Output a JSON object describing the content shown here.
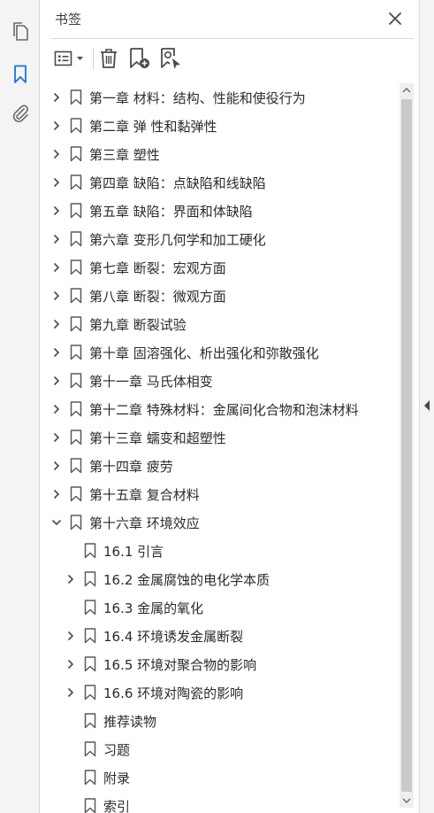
{
  "panel": {
    "title": "书签"
  },
  "toolbar": {
    "options_icon": "list-options-icon",
    "delete_icon": "trash-icon",
    "new_bookmark_icon": "bookmark-add-icon",
    "find_bookmark_icon": "bookmark-search-icon"
  },
  "colors": {
    "accent": "#1473e6",
    "rail_bg": "#f4f4f4",
    "scroll_thumb": "#c9c9c9"
  },
  "bookmarks": [
    {
      "label": "第一章 材料：结构、性能和使役行为",
      "level": 0,
      "state": "collapsed"
    },
    {
      "label": "第二章 弹 性和黏弹性",
      "level": 0,
      "state": "collapsed"
    },
    {
      "label": "第三章 塑性",
      "level": 0,
      "state": "collapsed"
    },
    {
      "label": "第四章 缺陷：点缺陷和线缺陷",
      "level": 0,
      "state": "collapsed"
    },
    {
      "label": "第五章 缺陷：界面和体缺陷",
      "level": 0,
      "state": "collapsed"
    },
    {
      "label": "第六章 变形几何学和加工硬化",
      "level": 0,
      "state": "collapsed"
    },
    {
      "label": "第七章 断裂：宏观方面",
      "level": 0,
      "state": "collapsed"
    },
    {
      "label": "第八章 断裂：微观方面",
      "level": 0,
      "state": "collapsed"
    },
    {
      "label": "第九章 断裂试验",
      "level": 0,
      "state": "collapsed"
    },
    {
      "label": "第十章 固溶强化、析出强化和弥散强化",
      "level": 0,
      "state": "collapsed"
    },
    {
      "label": "第十一章 马氏体相变",
      "level": 0,
      "state": "collapsed"
    },
    {
      "label": "第十二章 特殊材料：金属间化合物和泡沫材料",
      "level": 0,
      "state": "collapsed"
    },
    {
      "label": "第十三章 蠕变和超塑性",
      "level": 0,
      "state": "collapsed"
    },
    {
      "label": "第十四章 疲劳",
      "level": 0,
      "state": "collapsed"
    },
    {
      "label": "第十五章 复合材料",
      "level": 0,
      "state": "collapsed"
    },
    {
      "label": "第十六章 环境效应",
      "level": 0,
      "state": "expanded"
    },
    {
      "label": "16.1 引言",
      "level": 1,
      "state": "leaf"
    },
    {
      "label": "16.2 金属腐蚀的电化学本质",
      "level": 1,
      "state": "collapsed"
    },
    {
      "label": "16.3 金属的氧化",
      "level": 1,
      "state": "leaf"
    },
    {
      "label": "16.4 环境诱发金属断裂",
      "level": 1,
      "state": "collapsed"
    },
    {
      "label": "16.5 环境对聚合物的影响",
      "level": 1,
      "state": "collapsed"
    },
    {
      "label": "16.6 环境对陶瓷的影响",
      "level": 1,
      "state": "collapsed"
    },
    {
      "label": "推荐读物",
      "level": 1,
      "state": "leaf"
    },
    {
      "label": "习题",
      "level": 1,
      "state": "leaf"
    },
    {
      "label": "附录",
      "level": 1,
      "state": "leaf"
    },
    {
      "label": "索引",
      "level": 1,
      "state": "leaf"
    }
  ]
}
